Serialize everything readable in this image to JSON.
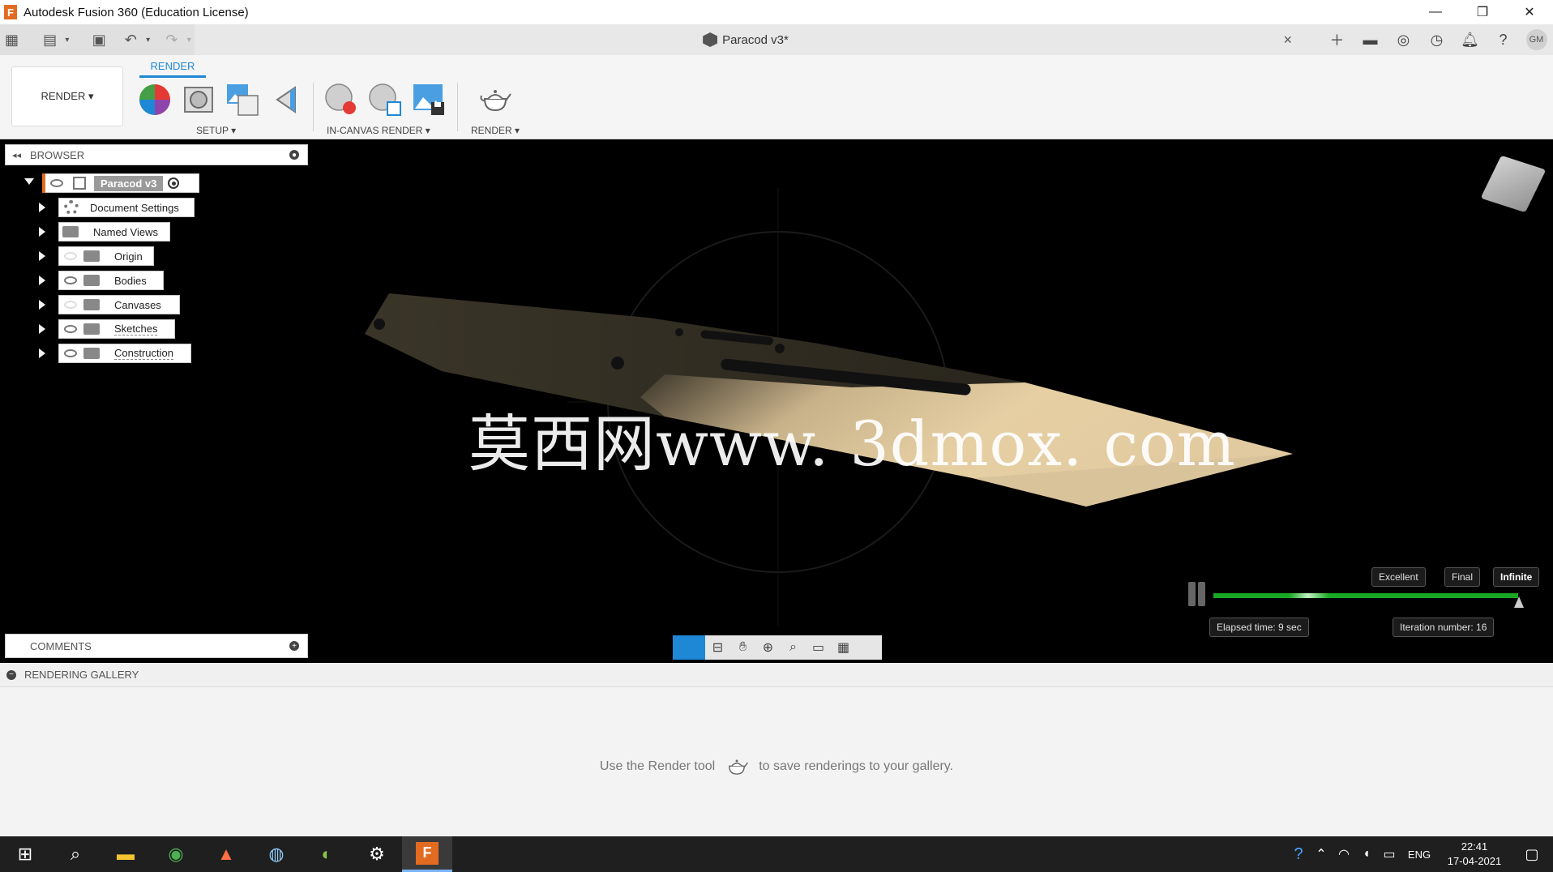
{
  "window": {
    "title": "Autodesk Fusion 360 (Education License)",
    "minimize": "—",
    "maximize": "❐",
    "close": "✕"
  },
  "document": {
    "tab_title": "Paracod v3*",
    "close": "×"
  },
  "user": {
    "initials": "GM"
  },
  "ribbon": {
    "workspace": "RENDER ▾",
    "active_tab": "RENDER",
    "groups": [
      "SETUP ▾",
      "IN-CANVAS RENDER ▾",
      "RENDER ▾"
    ]
  },
  "browser": {
    "label": "BROWSER",
    "collapse": "◂◂",
    "root": "Paracod v3",
    "items": [
      {
        "label": "Document Settings",
        "icon": "gear-icon"
      },
      {
        "label": "Named Views",
        "icon": "folder-icon"
      },
      {
        "label": "Origin",
        "icon": "folder-icon",
        "visible": false
      },
      {
        "label": "Bodies",
        "icon": "folder-icon",
        "visible": true
      },
      {
        "label": "Canvases",
        "icon": "folder-icon",
        "visible": false
      },
      {
        "label": "Sketches",
        "icon": "folder-icon",
        "visible": true
      },
      {
        "label": "Construction",
        "icon": "folder-icon",
        "visible": true
      }
    ]
  },
  "comments": {
    "label": "COMMENTS"
  },
  "watermark": "莫西网www. 3dmox. com",
  "render_progress": {
    "quality_levels": [
      "Excellent",
      "Final",
      "Infinite"
    ],
    "elapsed": "Elapsed time: 9 sec",
    "iteration": "Iteration number: 16",
    "progress": 1.0
  },
  "gallery": {
    "label": "RENDERING GALLERY",
    "message_before": "Use the Render tool",
    "message_after": "to save renderings to your gallery."
  },
  "taskbar": {
    "lang": "ENG",
    "time": "22:41",
    "date": "17-04-2021"
  },
  "colors": {
    "accent": "#1e88d6",
    "fusion_orange": "#e36b21",
    "progress_green": "#19a823",
    "blade": "#e2caa0"
  }
}
